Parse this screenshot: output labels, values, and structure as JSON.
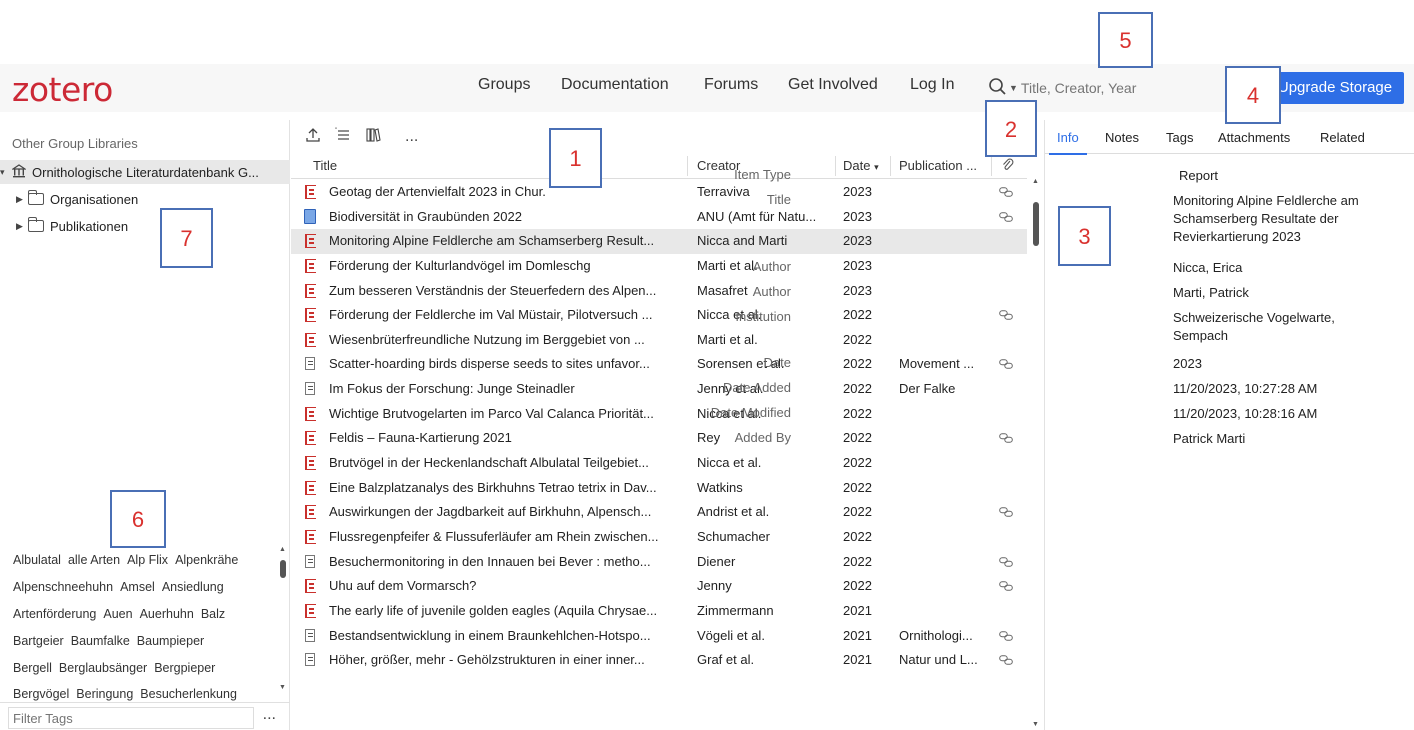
{
  "app": {
    "logo": "zotero"
  },
  "nav": {
    "groups": "Groups",
    "documentation": "Documentation",
    "forums": "Forums",
    "get_involved": "Get Involved",
    "login": "Log In"
  },
  "search": {
    "placeholder": "Title, Creator, Year"
  },
  "upgrade": {
    "label": "Upgrade Storage"
  },
  "sidebar": {
    "heading": "Other Group Libraries",
    "library": "Ornithologische Literaturdatenbank G...",
    "folders": [
      "Organisationen",
      "Publikationen"
    ]
  },
  "tags": {
    "lines": [
      [
        "Albulatal",
        "alle Arten",
        "Alp Flix",
        "Alpenkrähe"
      ],
      [
        "Alpenschneehuhn",
        "Amsel",
        "Ansiedlung"
      ],
      [
        "Artenförderung",
        "Auen",
        "Auerhuhn",
        "Balz"
      ],
      [
        "Bartgeier",
        "Baumfalke",
        "Baumpieper"
      ],
      [
        "Bergell",
        "Berglaubsänger",
        "Bergpieper"
      ],
      [
        "Bergvögel",
        "Beringung",
        "Besucherlenkung"
      ]
    ],
    "filter_placeholder": "Filter Tags",
    "menu": "..."
  },
  "toolbar": {
    "more": "..."
  },
  "columns": {
    "title": "Title",
    "creator": "Creator",
    "date": "Date",
    "publication": "Publication ..."
  },
  "items": [
    {
      "type": "report",
      "title": "Geotag der Artenvielfalt 2023 in Chur.",
      "creator": "Terraviva",
      "date": "2023",
      "pub": "",
      "link": true
    },
    {
      "type": "book",
      "title": "Biodiversität in Graubünden 2022",
      "creator": "ANU (Amt für Natu...",
      "date": "2023",
      "pub": "",
      "link": true
    },
    {
      "type": "report",
      "title": "Monitoring Alpine Feldlerche am Schamserberg Result...",
      "creator": "Nicca and Marti",
      "date": "2023",
      "pub": "",
      "link": false,
      "selected": true
    },
    {
      "type": "report",
      "title": "Förderung der Kulturlandvögel im Domleschg",
      "creator": "Marti et al.",
      "date": "2023",
      "pub": "",
      "link": false
    },
    {
      "type": "report",
      "title": "Zum besseren Verständnis der Steuerfedern des Alpen...",
      "creator": "Masafret",
      "date": "2023",
      "pub": "",
      "link": false
    },
    {
      "type": "report",
      "title": "Förderung der Feldlerche im Val Müstair, Pilotversuch ...",
      "creator": "Nicca et al.",
      "date": "2022",
      "pub": "",
      "link": true
    },
    {
      "type": "report",
      "title": "Wiesenbrüterfreundliche Nutzung im Berggebiet von ...",
      "creator": "Marti et al.",
      "date": "2022",
      "pub": "",
      "link": false
    },
    {
      "type": "article",
      "title": "Scatter-hoarding birds disperse seeds to sites unfavor...",
      "creator": "Sorensen et al.",
      "date": "2022",
      "pub": "Movement ...",
      "link": true
    },
    {
      "type": "article",
      "title": "Im Fokus der Forschung: Junge Steinadler",
      "creator": "Jenny et al.",
      "date": "2022",
      "pub": "Der Falke",
      "link": false
    },
    {
      "type": "report",
      "title": "Wichtige Brutvogelarten im Parco Val Calanca Priorität...",
      "creator": "Nicca et al.",
      "date": "2022",
      "pub": "",
      "link": false
    },
    {
      "type": "report",
      "title": "Feldis – Fauna-Kartierung 2021",
      "creator": "Rey",
      "date": "2022",
      "pub": "",
      "link": true
    },
    {
      "type": "report",
      "title": "Brutvögel in der Heckenlandschaft Albulatal Teilgebiet...",
      "creator": "Nicca et al.",
      "date": "2022",
      "pub": "",
      "link": false
    },
    {
      "type": "report",
      "title": "Eine Balzplatzanalys des Birkhuhns Tetrao tetrix in Dav...",
      "creator": "Watkins",
      "date": "2022",
      "pub": "",
      "link": false
    },
    {
      "type": "report",
      "title": "Auswirkungen der Jagdbarkeit auf Birkhuhn, Alpensch...",
      "creator": "Andrist et al.",
      "date": "2022",
      "pub": "",
      "link": true
    },
    {
      "type": "report",
      "title": "Flussregenpfeifer & Flussuferläufer am Rhein zwischen...",
      "creator": "Schumacher",
      "date": "2022",
      "pub": "",
      "link": false
    },
    {
      "type": "article",
      "title": "Besuchermonitoring in den Innauen bei Bever : metho...",
      "creator": "Diener",
      "date": "2022",
      "pub": "",
      "link": true
    },
    {
      "type": "report",
      "title": "Uhu auf dem Vormarsch?",
      "creator": "Jenny",
      "date": "2022",
      "pub": "",
      "link": true
    },
    {
      "type": "report",
      "title": "The early life of juvenile golden eagles (Aquila Chrysae...",
      "creator": "Zimmermann",
      "date": "2021",
      "pub": "",
      "link": false
    },
    {
      "type": "article",
      "title": "Bestandsentwicklung in einem Braunkehlchen-Hotspo...",
      "creator": "Vögeli et al.",
      "date": "2021",
      "pub": "Ornithologi...",
      "link": true
    },
    {
      "type": "article",
      "title": "Höher, größer, mehr - Gehölzstrukturen in einer inner...",
      "creator": "Graf et al.",
      "date": "2021",
      "pub": "Natur und L...",
      "link": true
    }
  ],
  "tabs": [
    "Info",
    "Notes",
    "Tags",
    "Attachments",
    "Related"
  ],
  "info": [
    {
      "label": "Item Type",
      "value": "Report"
    },
    {
      "label": "Title",
      "value": "Monitoring Alpine Feldlerche am Schamserberg Resultate der Revierkartierung 2023"
    },
    {
      "label": "Author",
      "value": "Nicca, Erica"
    },
    {
      "label": "Author",
      "value": "Marti, Patrick"
    },
    {
      "label": "Institution",
      "value": "Schweizerische Vogelwarte, Sempach"
    },
    {
      "label": "Date",
      "value": "2023"
    },
    {
      "label": "Date Added",
      "value": "11/20/2023, 10:27:28 AM"
    },
    {
      "label": "Date Modified",
      "value": "11/20/2023, 10:28:16 AM"
    },
    {
      "label": "Added By",
      "value": "Patrick Marti"
    }
  ],
  "annotations": [
    "1",
    "2",
    "3",
    "4",
    "5",
    "6",
    "7"
  ],
  "colors": {
    "accent": "#2e6ee6",
    "logo": "#cc2936",
    "annotation_border": "#4a6fb5",
    "annotation_text": "#d9312e"
  }
}
